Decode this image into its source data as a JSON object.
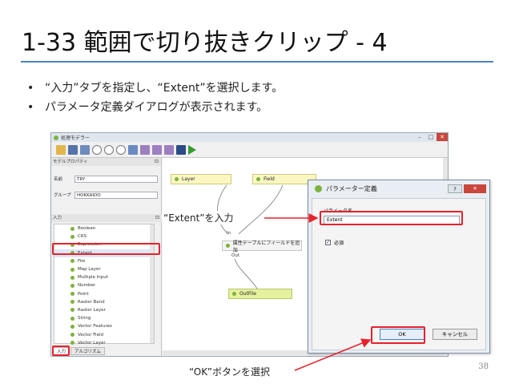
{
  "slide": {
    "title": "1-33 範囲で切り抜きクリップ - 4",
    "bullets": [
      "“入力”タブを指定し、“Extent”を選択します。",
      "パラメータ定義ダイアログが表示されます。"
    ],
    "page_number": "38"
  },
  "modeler": {
    "window_title": "処理モデラー",
    "properties_header": "モデルプロパティ",
    "name_label": "名前",
    "name_value": "TRY",
    "group_label": "グループ",
    "group_value": "HOKKAIDO",
    "inputs_header": "入力",
    "input_items": [
      "Boolean",
      "CRS",
      "Expression",
      "Extent",
      "File",
      "Map Layer",
      "Multiple Input",
      "Number",
      "Point",
      "Raster Band",
      "Raster Layer",
      "String",
      "Vector Features",
      "Vector Field",
      "Vector Layer"
    ],
    "tabs": [
      "入力",
      "アルゴリズム"
    ],
    "canvas": {
      "node_layer": "Layer",
      "node_field": "Field",
      "in_label": "In",
      "process_label": "属性テーブルにフィールドを追加",
      "out_label": "Out",
      "node_outfile": "OutFile"
    }
  },
  "dialog": {
    "title": "パラメーター定義",
    "help_button": "?",
    "close_button": "✕",
    "param_label": "パラメータ名",
    "param_value": "Extent",
    "required_label": "必須",
    "ok_button": "OK",
    "cancel_button": "キャンセル"
  },
  "annotations": {
    "extent_callout": "“Extent”を入力",
    "ok_callout": "“OK”ボタンを選択"
  }
}
